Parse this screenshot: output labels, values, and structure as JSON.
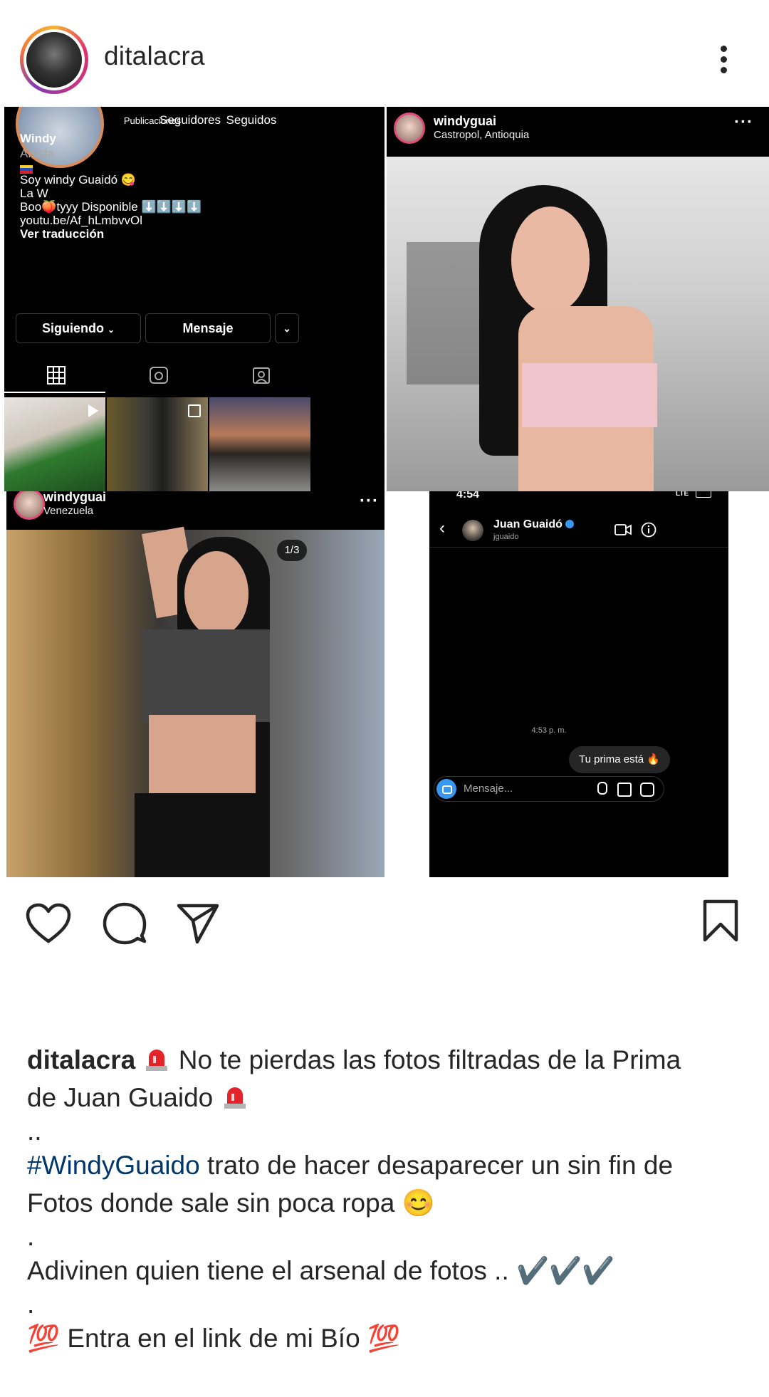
{
  "header": {
    "username": "ditalacra"
  },
  "collage": {
    "profile": {
      "stats": [
        {
          "label": "Publicaciones"
        },
        {
          "label": "Seguidores"
        },
        {
          "label": "Seguidos"
        }
      ],
      "name": "Windy",
      "category": "Artista",
      "bio_lines": [
        "Soy windy Guaidó 😋",
        "La W",
        "Boo🍑tyyy Disponible ⬇️⬇️⬇️⬇️",
        "youtu.be/Af_hLmbvvOl"
      ],
      "translate_link": "Ver traducción",
      "buttons": {
        "following": "Siguiendo",
        "message": "Mensaje"
      },
      "tabs": [
        "grid-icon",
        "reels-icon",
        "tagged-icon"
      ]
    },
    "post1": {
      "username": "windyguai",
      "location": "Castropol, Antioquia"
    },
    "post2": {
      "username": "windyguai",
      "location": "Venezuela",
      "counter": "1/3"
    },
    "dm": {
      "time": "4:54",
      "network": "LTE",
      "contact_name": "Juan Guaidó",
      "contact_handle": "jguaido",
      "timestamp": "4:53 p. m.",
      "message": "Tu prima está 🔥",
      "input_placeholder": "Mensaje..."
    }
  },
  "actions": [
    "like-icon",
    "comment-icon",
    "share-icon",
    "save-icon"
  ],
  "caption": {
    "username": "ditalacra",
    "line1": " No te pierdas las fotos filtradas de la Prima",
    "line2": "de Juan Guaido ",
    "sep1": "..",
    "hashtag": "#WindyGuaido",
    "line3": " trato de hacer desaparecer un sin fin de",
    "line4": "Fotos donde sale sin poca ropa 😊",
    "sep2": ".",
    "line5": "Adivinen quien tiene el arsenal de fotos .. ✔️✔️✔️",
    "sep3": ".",
    "line6": "💯 Entra en el link de mi Bío 💯"
  },
  "colors": {
    "text": "#262626",
    "hashtag": "#00376b",
    "verified": "#3897f0"
  }
}
